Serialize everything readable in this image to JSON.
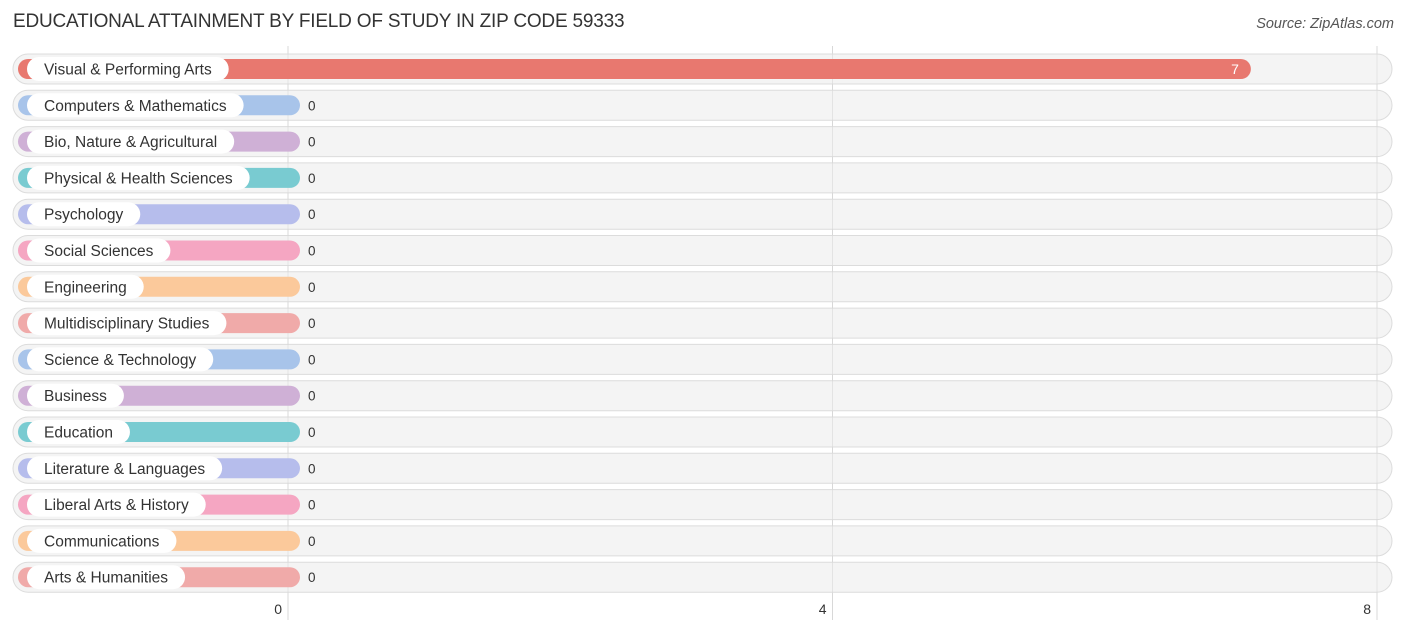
{
  "header": {
    "title": "EDUCATIONAL ATTAINMENT BY FIELD OF STUDY IN ZIP CODE 59333",
    "source": "Source: ZipAtlas.com"
  },
  "chart_data": {
    "type": "bar",
    "orientation": "horizontal",
    "title": "EDUCATIONAL ATTAINMENT BY FIELD OF STUDY IN ZIP CODE 59333",
    "xlabel": "",
    "ylabel": "",
    "xlim": [
      0,
      8
    ],
    "xticks": [
      0,
      4,
      8
    ],
    "grid": true,
    "legend": "none",
    "categories": [
      "Visual & Performing Arts",
      "Computers & Mathematics",
      "Bio, Nature & Agricultural",
      "Physical & Health Sciences",
      "Psychology",
      "Social Sciences",
      "Engineering",
      "Multidisciplinary Studies",
      "Science & Technology",
      "Business",
      "Education",
      "Literature & Languages",
      "Liberal Arts & History",
      "Communications",
      "Arts & Humanities"
    ],
    "values": [
      7,
      0,
      0,
      0,
      0,
      0,
      0,
      0,
      0,
      0,
      0,
      0,
      0,
      0,
      0
    ],
    "value_labels": [
      "7",
      "0",
      "0",
      "0",
      "0",
      "0",
      "0",
      "0",
      "0",
      "0",
      "0",
      "0",
      "0",
      "0",
      "0"
    ],
    "colors": [
      "#e8786f",
      "#a8c4ea",
      "#cfb0d6",
      "#79cbd1",
      "#b6bdec",
      "#f5a6c2",
      "#fbc99b",
      "#f0aaa9",
      "#a8c4ea",
      "#cfb0d6",
      "#79cbd1",
      "#b6bdec",
      "#f5a6c2",
      "#fbc99b",
      "#f0aaa9"
    ]
  }
}
